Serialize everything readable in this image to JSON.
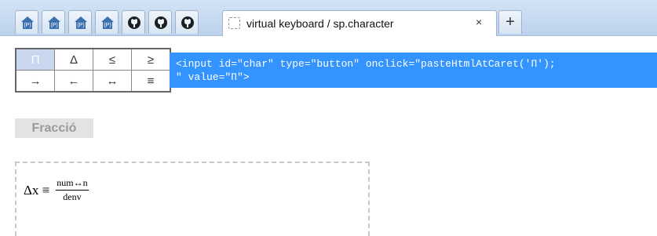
{
  "browser": {
    "active_tab": {
      "title": "virtual keyboard / sp.character",
      "close_label": "×"
    },
    "new_tab_label": "+",
    "pinned_tabs": [
      {
        "icon": "p-house-icon"
      },
      {
        "icon": "p-house-icon"
      },
      {
        "icon": "p-house-icon"
      },
      {
        "icon": "p-house-icon"
      },
      {
        "icon": "github-icon"
      },
      {
        "icon": "github-icon"
      }
    ]
  },
  "keyboard": {
    "row1": [
      "Π",
      "Δ",
      "≤",
      "≥"
    ],
    "row2": [
      "→",
      "←",
      "↔",
      "≡"
    ],
    "selected": "Π"
  },
  "code": {
    "line1": "<input id=\"char\" type=\"button\" onclick=\"pasteHtmlAtCaret('Π');",
    "line2": "\" value=\"Π\">"
  },
  "fraction_button": "Fracció",
  "formula": {
    "lhs": "Δx ≡",
    "numerator": "num↔n",
    "denominator": "denv"
  },
  "colors": {
    "code_background": "#3394ff",
    "tabbar": "#c9dcf1"
  }
}
